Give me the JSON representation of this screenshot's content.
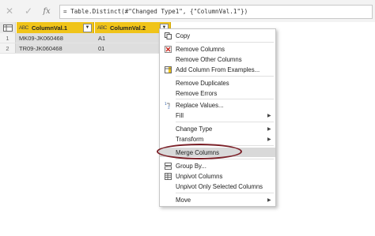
{
  "formula_bar": {
    "cancel_glyph": "✕",
    "commit_glyph": "✓",
    "fx_label": "fx",
    "formula": "= Table.Distinct(#\"Changed Type1\", {\"ColumnVal.1\"})"
  },
  "grid": {
    "columns": [
      {
        "type_label": "ABC",
        "name": "ColumnVal.1"
      },
      {
        "type_label": "ABC",
        "name": "ColumnVal.2"
      }
    ],
    "rows": [
      {
        "num": "1",
        "c1": "MK09-JK060468",
        "c2": "A1"
      },
      {
        "num": "2",
        "c1": "TR09-JK060468",
        "c2": "01"
      }
    ]
  },
  "menu": {
    "items": [
      {
        "label": "Copy",
        "icon": "copy-icon"
      },
      {
        "label": "Remove Columns",
        "icon": "remove-columns-icon"
      },
      {
        "label": "Remove Other Columns",
        "icon": ""
      },
      {
        "label": "Add Column From Examples...",
        "icon": "add-column-examples-icon"
      },
      {
        "label": "Remove Duplicates",
        "icon": ""
      },
      {
        "label": "Remove Errors",
        "icon": ""
      },
      {
        "label": "Replace Values...",
        "icon": "replace-values-icon"
      },
      {
        "label": "Fill",
        "icon": ""
      },
      {
        "label": "Change Type",
        "icon": ""
      },
      {
        "label": "Transform",
        "icon": ""
      },
      {
        "label": "Merge Columns",
        "icon": ""
      },
      {
        "label": "Group By...",
        "icon": "group-by-icon"
      },
      {
        "label": "Unpivot Columns",
        "icon": "unpivot-icon"
      },
      {
        "label": "Unpivot Only Selected Columns",
        "icon": ""
      },
      {
        "label": "Move",
        "icon": ""
      }
    ],
    "highlighted": "Merge Columns",
    "annotation_color": "#7b1f27"
  },
  "colors": {
    "header_accent": "#f0c419",
    "row_selected": "#dedede"
  }
}
